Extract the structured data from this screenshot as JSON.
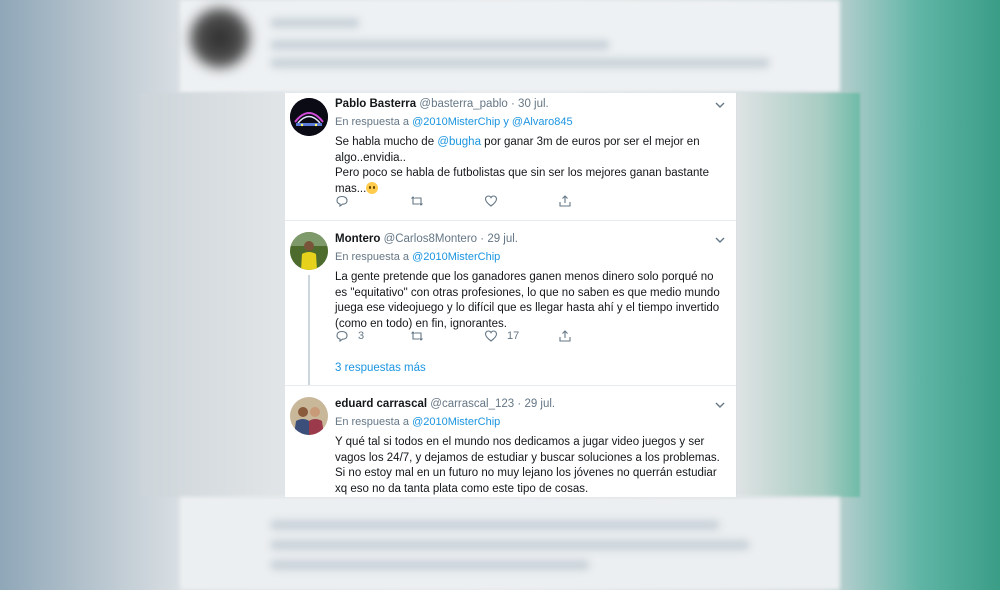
{
  "tweets": [
    {
      "name": "Pablo Basterra",
      "handle": "@basterra_pablo",
      "date": "30 jul.",
      "reply_prefix": "En respuesta a",
      "reply_to_1": "@2010MisterChip",
      "reply_join": "y",
      "reply_to_2": "@Alvaro845",
      "text_a": "Se habla mucho de",
      "text_mention": "@bugha",
      "text_b": "por ganar 3m de euros por ser el mejor en algo..envidia..",
      "text_c": "Pero poco se habla de futbolistas que sin ser los mejores ganan bastante mas...",
      "replies": "",
      "likes": ""
    },
    {
      "name": "Montero",
      "handle": "@Carlos8Montero",
      "date": "29 jul.",
      "reply_prefix": "En respuesta a",
      "reply_to_1": "@2010MisterChip",
      "text": "La gente pretende que los ganadores ganen menos dinero solo porqué no es \"equitativo\" con otras profesiones, lo que no saben es que medio mundo juega ese videojuego y lo difícil que es llegar hasta ahí y el tiempo invertido (como en todo) en fin, ignorantes.",
      "replies": "3",
      "likes": "17",
      "more_replies": "3 respuestas más"
    },
    {
      "name": "eduard carrascal",
      "handle": "@carrascal_123",
      "date": "29 jul.",
      "reply_prefix": "En respuesta a",
      "reply_to_1": "@2010MisterChip",
      "text": "Y qué tal si todos en el mundo nos dedicamos a jugar video juegos y ser vagos los 24/7, y dejamos de estudiar y buscar soluciones a los problemas. Si no estoy mal en un futuro no muy lejano los jóvenes no querrán estudiar xq eso no da tanta plata como este tipo de cosas."
    }
  ],
  "colors": {
    "link": "#1b95e0",
    "muted": "#657786",
    "text": "#14171a"
  },
  "icons": [
    "chevron-down-icon",
    "reply-icon",
    "retweet-icon",
    "like-icon",
    "share-icon"
  ]
}
